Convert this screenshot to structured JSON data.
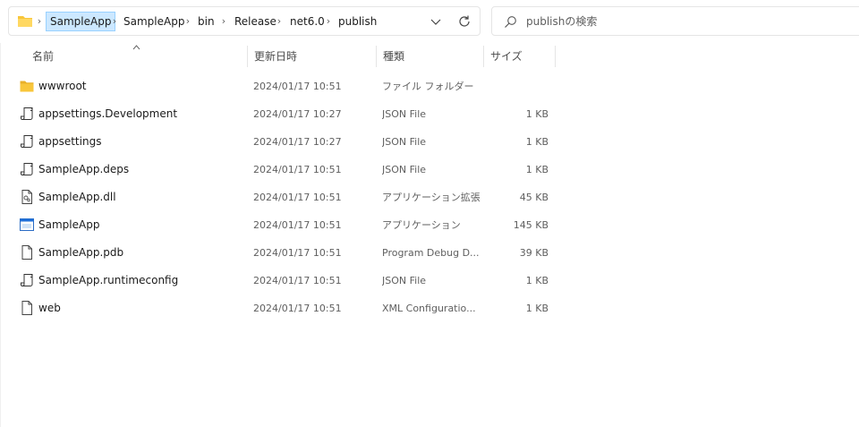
{
  "address_bar": {
    "breadcrumbs": [
      "SampleApp",
      "SampleApp",
      "bin",
      "Release",
      "net6.0",
      "publish"
    ],
    "selected_index": 0
  },
  "search": {
    "placeholder": "publishの検索"
  },
  "columns": {
    "name": "名前",
    "date": "更新日時",
    "type": "種類",
    "size": "サイズ"
  },
  "files": [
    {
      "name": "wwwroot",
      "date": "2024/01/17 10:51",
      "type": "ファイル フォルダー",
      "size": "",
      "icon": "folder-icon"
    },
    {
      "name": "appsettings.Development",
      "date": "2024/01/17 10:27",
      "type": "JSON File",
      "size": "1 KB",
      "icon": "json-file-icon"
    },
    {
      "name": "appsettings",
      "date": "2024/01/17 10:27",
      "type": "JSON File",
      "size": "1 KB",
      "icon": "json-file-icon"
    },
    {
      "name": "SampleApp.deps",
      "date": "2024/01/17 10:51",
      "type": "JSON File",
      "size": "1 KB",
      "icon": "json-file-icon"
    },
    {
      "name": "SampleApp.dll",
      "date": "2024/01/17 10:51",
      "type": "アプリケーション拡張",
      "size": "45 KB",
      "icon": "dll-file-icon"
    },
    {
      "name": "SampleApp",
      "date": "2024/01/17 10:51",
      "type": "アプリケーション",
      "size": "145 KB",
      "icon": "application-icon"
    },
    {
      "name": "SampleApp.pdb",
      "date": "2024/01/17 10:51",
      "type": "Program Debug D...",
      "size": "39 KB",
      "icon": "blank-file-icon"
    },
    {
      "name": "SampleApp.runtimeconfig",
      "date": "2024/01/17 10:51",
      "type": "JSON File",
      "size": "1 KB",
      "icon": "json-file-icon"
    },
    {
      "name": "web",
      "date": "2024/01/17 10:51",
      "type": "XML Configuratio...",
      "size": "1 KB",
      "icon": "blank-file-icon"
    }
  ],
  "colors": {
    "folder": "#f8c63b",
    "selection": "#cce8ff",
    "selection_border": "#99d1ff",
    "app_icon": "#1e6fd9"
  }
}
